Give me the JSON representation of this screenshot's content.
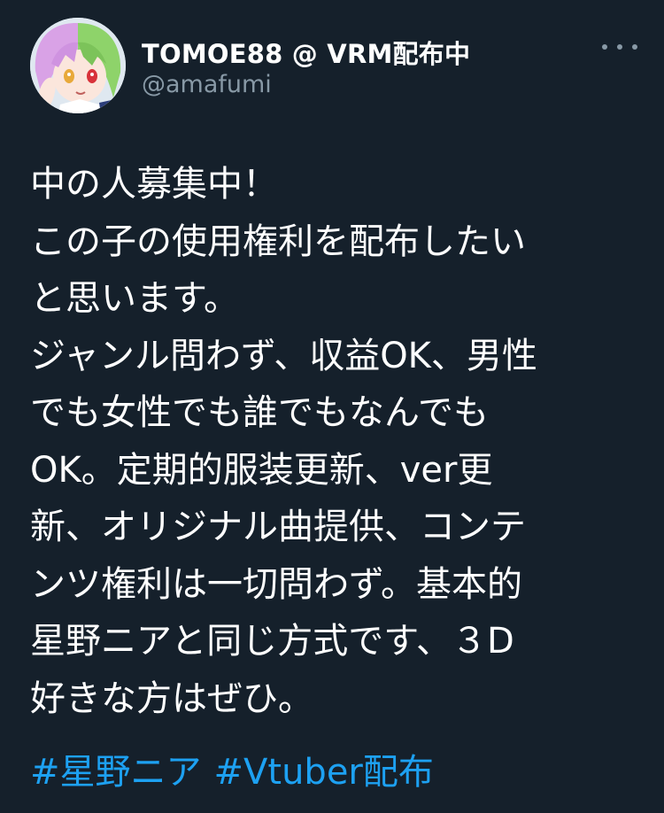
{
  "author": {
    "display_name": "TOMOE88 @ VRM配布中",
    "handle": "@amafumi",
    "avatar_icon": "avatar-anime-character"
  },
  "more_icon": "more-horizontal-icon",
  "tweet": {
    "lines": [
      "中の人募集中！",
      "この子の使用権利を配布したい",
      "と思います。",
      "ジャンル問わず、収益OK、男性",
      "でも女性でも誰でもなんでも",
      "OK。定期的服装更新、ver更",
      "新、オリジナル曲提供、コンテ",
      "ンツ権利は一切問わず。基本的",
      "星野ニアと同じ方式です、３D",
      "好きな方はぜひ。"
    ],
    "hashtags": [
      "#星野ニア",
      "#Vtuber配布"
    ]
  },
  "colors": {
    "background": "#15202b",
    "text": "#ffffff",
    "secondary": "#8899a6",
    "link": "#1da1f2"
  }
}
